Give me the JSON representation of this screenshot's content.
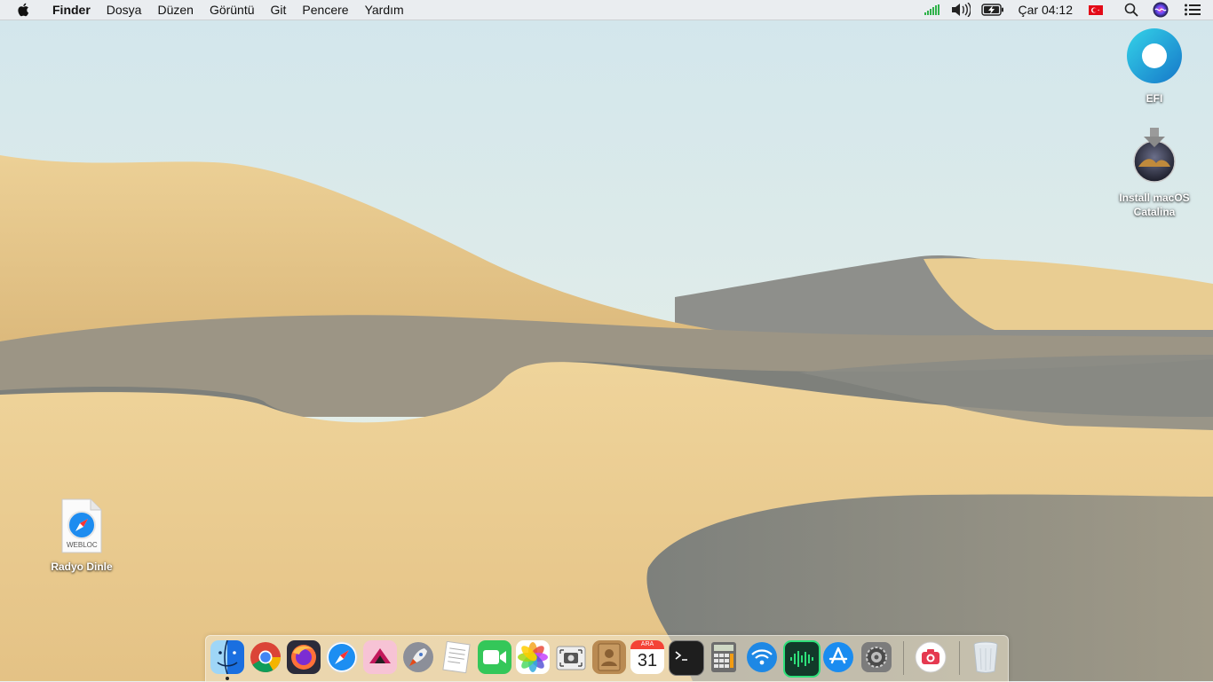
{
  "menubar": {
    "app_name": "Finder",
    "menus": [
      "Dosya",
      "Düzen",
      "Görüntü",
      "Git",
      "Pencere",
      "Yardım"
    ],
    "clock": "Çar 04:12"
  },
  "desktop": {
    "icons": [
      {
        "label": "EFI",
        "icon": "efi-drive-icon"
      },
      {
        "label": "Install macOS Catalina",
        "label_lines": [
          "Install macOS",
          "Catalina"
        ],
        "icon": "install-catalina-icon"
      },
      {
        "label": "Radyo Dinle",
        "icon": "webloc-file-icon",
        "badge": "WEBLOC"
      }
    ]
  },
  "dock": {
    "calendar": {
      "month": "ARA",
      "day": "31"
    },
    "apps": [
      "finder",
      "chrome",
      "firefox",
      "safari",
      "affinity",
      "launchpad",
      "textedit",
      "facetime",
      "photos",
      "screenshot",
      "contacts",
      "calendar",
      "terminal",
      "calculator",
      "wifi-utility",
      "audio-editor",
      "app-store",
      "system-preferences",
      "photo-booth",
      "trash"
    ]
  },
  "colors": {
    "sky_top": "#d3e7ec",
    "sand_light": "#e8c98a",
    "sand_shadow": "#8d8f8a",
    "menubar_bg": "#eceef0",
    "dock_bg": "#f0e8d0"
  }
}
